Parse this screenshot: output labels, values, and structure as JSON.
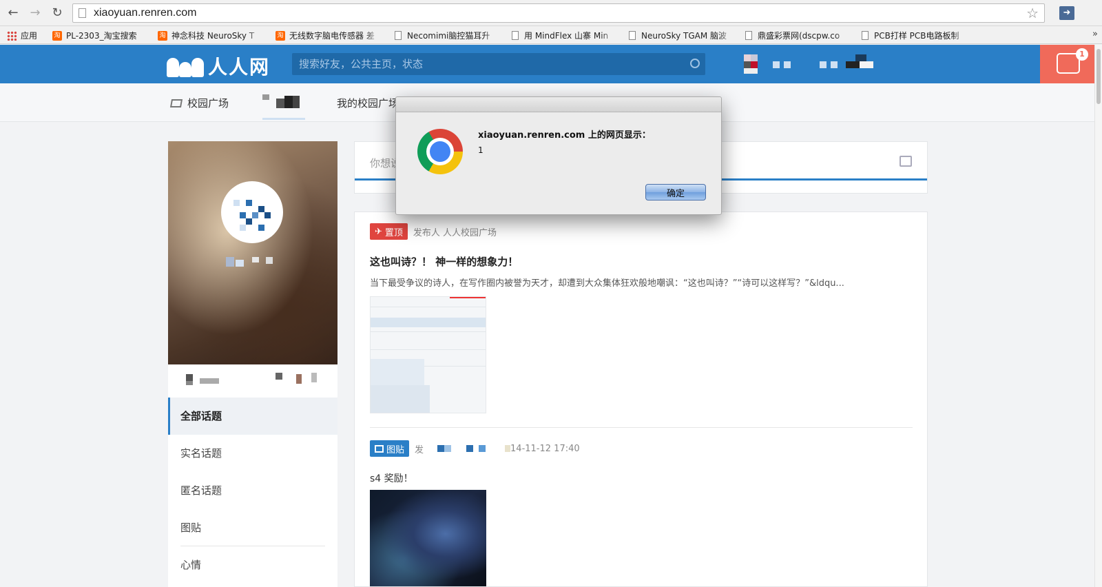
{
  "browser": {
    "url": "xiaoyuan.renren.com",
    "bookmarks": [
      {
        "label": "应用",
        "icon": "apps-grid-icon"
      },
      {
        "label": "PL-2303_淘宝搜索",
        "icon": "taobao-icon"
      },
      {
        "label": "神念科技 NeuroSky T",
        "icon": "taobao-icon"
      },
      {
        "label": "无线数字脑电传感器 差",
        "icon": "taobao-icon"
      },
      {
        "label": "Necomimi脑控猫耳升",
        "icon": "page-icon"
      },
      {
        "label": "用 MindFlex 山寨 Min",
        "icon": "page-icon"
      },
      {
        "label": "NeuroSky TGAM 脑波",
        "icon": "page-icon"
      },
      {
        "label": "鼎盛彩票网(dscpw.co",
        "icon": "page-icon"
      },
      {
        "label": "PCB打样 PCB电路板制",
        "icon": "page-icon"
      }
    ],
    "bookmarks_more": "»"
  },
  "site": {
    "logo_text": "人人网",
    "search_placeholder": "搜索好友，公共主页，状态",
    "notification_count": "1",
    "tabs": {
      "plaza": "校园广场",
      "my_plaza": "我的校园广场"
    }
  },
  "sidebar": {
    "menu": [
      "全部话题",
      "实名话题",
      "匿名话题",
      "图贴",
      "心情"
    ]
  },
  "composer": {
    "placeholder": "你想说"
  },
  "feed": {
    "post1": {
      "badge": "置顶",
      "meta": "发布人 人人校园广场",
      "title": "这也叫诗？！ 神一样的想象力！",
      "excerpt": "当下最受争议的诗人，在写作圈内被誉为天才，却遭到大众集体狂欢般地嘲讽：“这也叫诗？”“诗可以这样写？”&ldqu..."
    },
    "post2": {
      "badge": "图贴",
      "meta_prefix": "发",
      "date": "14-11-12 17:40",
      "text": "s4 奖励！"
    }
  },
  "dialog": {
    "title": "xiaoyuan.renren.com 上的网页显示：",
    "message": "1",
    "ok_label": "确定"
  }
}
